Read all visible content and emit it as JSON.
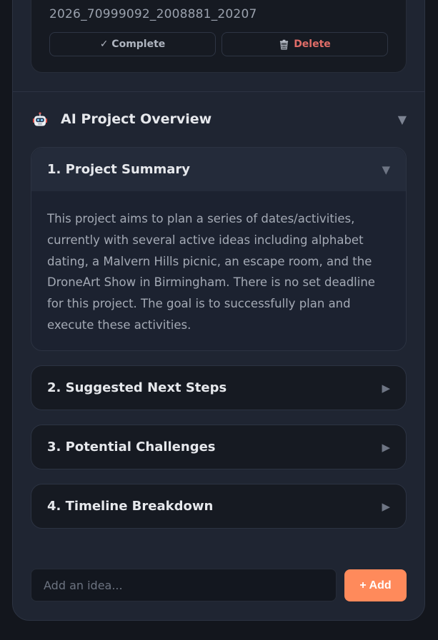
{
  "idea_card": {
    "id_text": "2026_70999092_2008881_20207",
    "complete_label": "✓ Complete",
    "delete_label": "Delete"
  },
  "overview": {
    "title": "AI Project Overview",
    "caret": "▼"
  },
  "sections": [
    {
      "title": "1. Project Summary",
      "caret": "▼",
      "body": "This project aims to plan a series of dates/activities, currently with several active ideas including alphabet dating, a Malvern Hills picnic, an escape room, and the DroneArt Show in Birmingham. There is no set deadline for this project. The goal is to successfully plan and execute these activities."
    },
    {
      "title": "2. Suggested Next Steps",
      "caret": "▶"
    },
    {
      "title": "3. Potential Challenges",
      "caret": "▶"
    },
    {
      "title": "4. Timeline Breakdown",
      "caret": "▶"
    }
  ],
  "add_idea": {
    "placeholder": "Add an idea...",
    "button_label": "+ Add"
  },
  "colors": {
    "accent": "#ff8a5b",
    "danger": "#e06d68",
    "panel": "#1f2532",
    "background": "#13161d"
  }
}
